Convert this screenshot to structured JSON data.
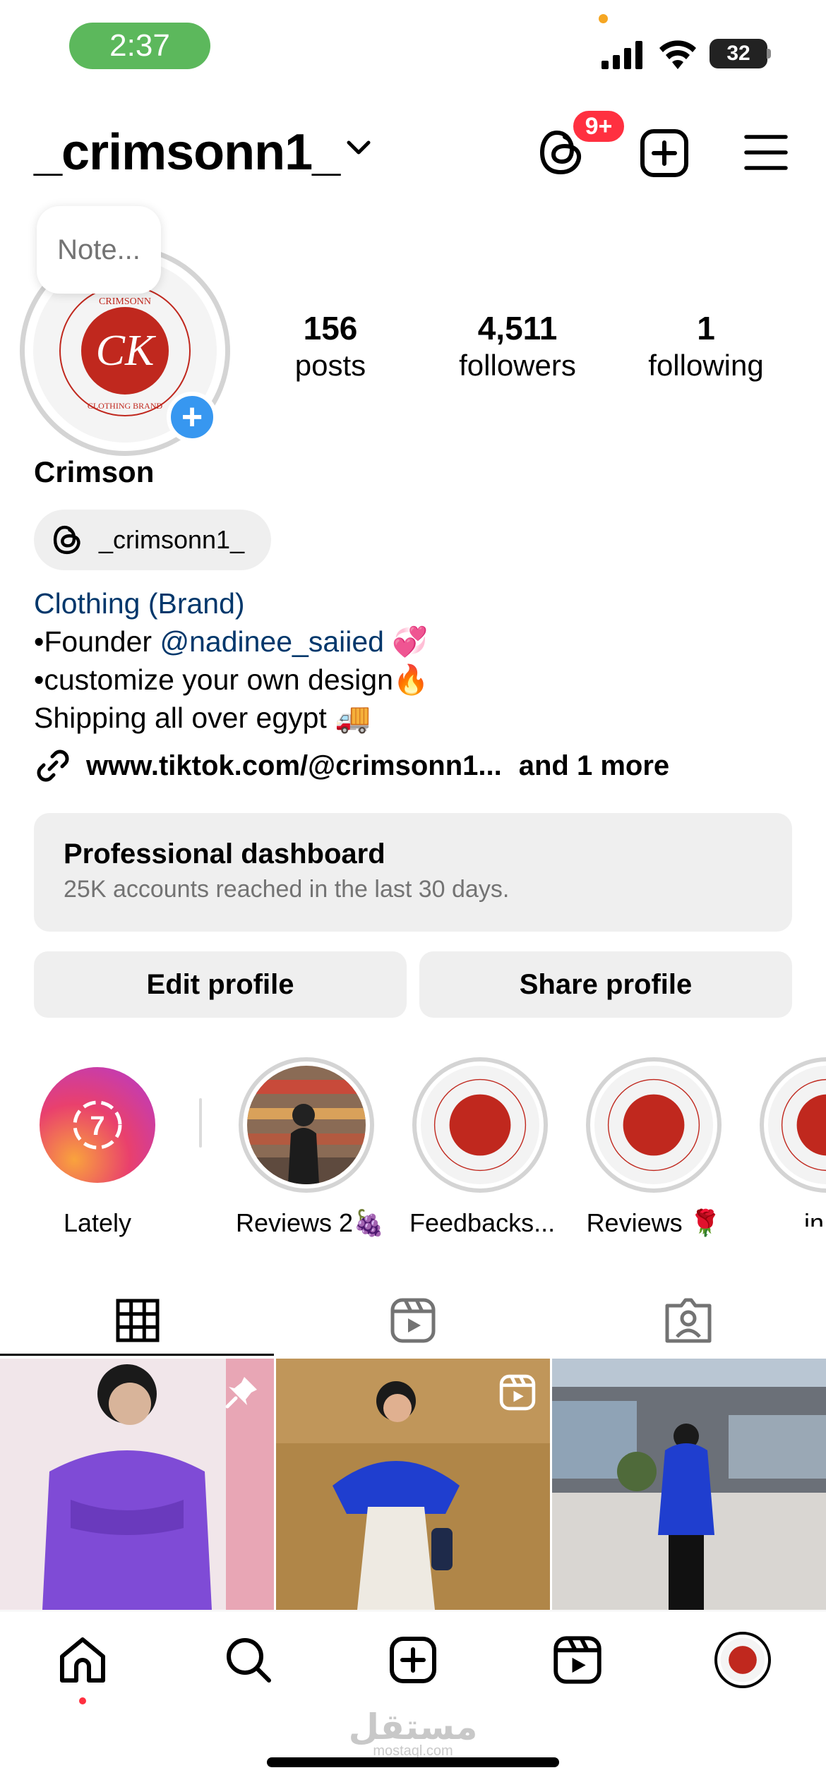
{
  "status_bar": {
    "time": "2:37",
    "battery": "32"
  },
  "header": {
    "username": "_crimsonn1_",
    "threads_badge": "9+"
  },
  "profile": {
    "note_placeholder": "Note...",
    "avatar_text_top": "CRIMSONN",
    "avatar_monogram": "CK",
    "avatar_text_bottom": "CLOTHING BRAND",
    "stats": [
      {
        "value": "156",
        "label": "posts"
      },
      {
        "value": "4,511",
        "label": "followers"
      },
      {
        "value": "1",
        "label": "following"
      }
    ],
    "display_name": "Crimson",
    "threads_handle": "_crimsonn1_",
    "bio": {
      "category": "Clothing (Brand)",
      "line1_prefix": "•Founder ",
      "line1_mention": "@nadinee_saiied",
      "line1_emoji": "💞",
      "line2": "•customize your own design🔥",
      "line3": "Shipping all over egypt 🚚"
    },
    "link": {
      "url": "www.tiktok.com/@crimsonn1...",
      "more": "and 1 more"
    }
  },
  "dashboard": {
    "title": "Professional dashboard",
    "subtitle": "25K accounts reached in the last 30 days."
  },
  "buttons": {
    "edit": "Edit profile",
    "share": "Share profile"
  },
  "highlights": [
    {
      "label": "Lately",
      "count": "7"
    },
    {
      "label": "Reviews 2🍇"
    },
    {
      "label": "Feedbacks..."
    },
    {
      "label": "Reviews 🌹"
    },
    {
      "label": "in st"
    }
  ],
  "tabs": [
    "grid-icon",
    "reels-icon",
    "tagged-icon"
  ],
  "nav": [
    "home-icon",
    "search-icon",
    "create-icon",
    "reels-icon",
    "profile-avatar"
  ],
  "watermark": {
    "arabic": "مستقل",
    "latin": "mostaql.com"
  },
  "colors": {
    "link_blue": "#00376b",
    "accent_blue": "#3797f0",
    "badge_red": "#ff3040",
    "brand_red": "#c0281e",
    "time_green": "#5cb85c"
  }
}
